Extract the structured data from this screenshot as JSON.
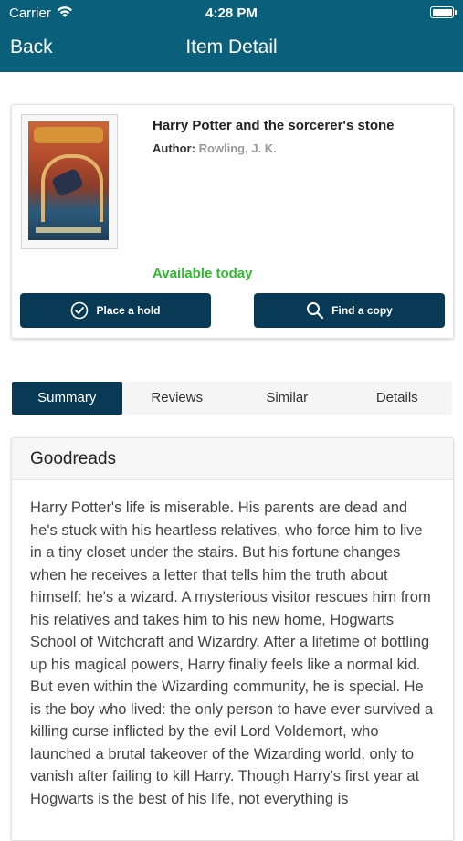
{
  "status_bar": {
    "carrier": "Carrier",
    "time": "4:28 PM"
  },
  "nav": {
    "back_label": "Back",
    "title": "Item Detail"
  },
  "item": {
    "title": "Harry Potter and the sorcerer's stone",
    "author_label": "Author:",
    "author": "Rowling, J. K.",
    "availability": "Available today",
    "place_hold_label": "Place a hold",
    "find_copy_label": "Find a copy"
  },
  "tabs": [
    {
      "label": "Summary",
      "active": true
    },
    {
      "label": "Reviews",
      "active": false
    },
    {
      "label": "Similar",
      "active": false
    },
    {
      "label": "Details",
      "active": false
    }
  ],
  "summary": {
    "source": "Goodreads",
    "text": "Harry Potter's life is miserable. His parents are dead and he's stuck with his heartless relatives, who force him to live in a tiny closet under the stairs. But his fortune changes when he receives a letter that tells him the truth about himself: he's a wizard. A mysterious visitor rescues him from his relatives and takes him to his new home, Hogwarts School of Witchcraft and Wizardry. After a lifetime of bottling up his magical powers, Harry finally feels like a normal kid. But even within the Wizarding community, he is special. He is the boy who lived: the only person to have ever survived a killing curse inflicted by the evil Lord Voldemort, who launched a brutal takeover of the Wizarding world, only to vanish after failing to kill Harry. Though Harry's first year at Hogwarts is the best of his life, not everything is"
  },
  "colors": {
    "header_bg": "#0a5f7b",
    "button_bg": "#083a55",
    "available": "#2fba2f"
  },
  "icons": [
    "wifi-icon",
    "battery-icon",
    "checkmark-circle-icon",
    "search-icon"
  ]
}
